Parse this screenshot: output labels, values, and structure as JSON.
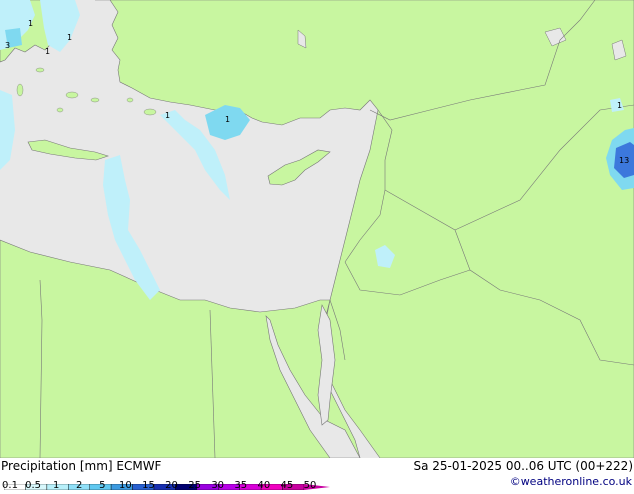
{
  "title": {
    "left": "Precipitation [mm] ECMWF",
    "right": "Sa 25-01-2025 00..06 UTC (00+222)"
  },
  "credit": "©weatheronline.co.uk",
  "colors": {
    "sea": "#e8e8e8",
    "land": "#c8f6a0",
    "border": "#777777",
    "precip_light": "#bff0fa",
    "precip_medium": "#7fd9f0",
    "precip_heavy": "#3c78dc"
  },
  "legend": {
    "ticks": [
      "0.1",
      "0.5",
      "1",
      "2",
      "5",
      "10",
      "15",
      "20",
      "25",
      "30",
      "35",
      "40",
      "45",
      "50"
    ],
    "colors": [
      "#ffffff",
      "#d8f8fc",
      "#b8f0fa",
      "#90e0f8",
      "#60c8f0",
      "#3c9ae0",
      "#2860d0",
      "#1830b0",
      "#000070",
      "#9a00e0",
      "#b800e8",
      "#d800d8",
      "#f000c0",
      "#c800a0"
    ]
  },
  "map_labels": [
    {
      "text": "13"
    },
    {
      "text": "1"
    },
    {
      "text": "1"
    },
    {
      "text": "1"
    },
    {
      "text": "3"
    },
    {
      "text": "1"
    },
    {
      "text": "1"
    },
    {
      "text": "1"
    }
  ]
}
